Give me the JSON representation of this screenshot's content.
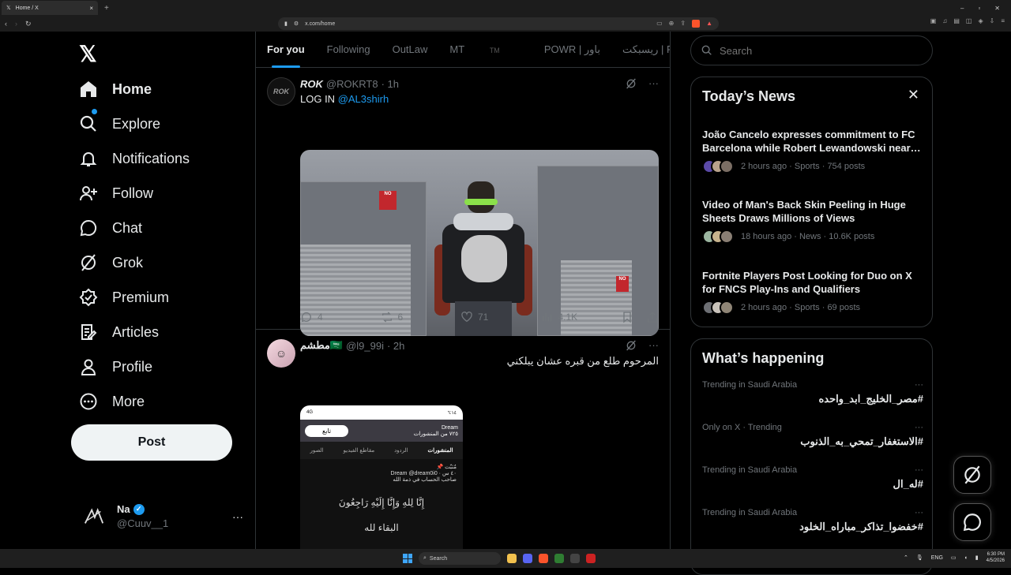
{
  "browser": {
    "tab_title": "Home / X",
    "url": "x.com/home",
    "new_tab": "+",
    "tab_close": "×",
    "win_min": "‒",
    "win_max": "▫",
    "win_close": "✕"
  },
  "sidebar": {
    "logo": "𝕏",
    "items": [
      {
        "label": "Home",
        "icon": "home-icon"
      },
      {
        "label": "Explore",
        "icon": "search-icon"
      },
      {
        "label": "Notifications",
        "icon": "bell-icon"
      },
      {
        "label": "Follow",
        "icon": "person-add-icon"
      },
      {
        "label": "Chat",
        "icon": "chat-icon"
      },
      {
        "label": "Grok",
        "icon": "grok-icon"
      },
      {
        "label": "Premium",
        "icon": "premium-icon"
      },
      {
        "label": "Articles",
        "icon": "articles-icon"
      },
      {
        "label": "Profile",
        "icon": "person-icon"
      },
      {
        "label": "More",
        "icon": "more-circle-icon"
      }
    ],
    "post_label": "Post",
    "account": {
      "name": "Na",
      "handle": "@Cuuv__1",
      "more": "···"
    }
  },
  "timeline": {
    "tabs": [
      "For you",
      "Following",
      "OutLaw",
      "MT",
      "POWR | باور",
      "ريسبكت | Respect"
    ],
    "tab_mt_suffix": "TM",
    "tweets": [
      {
        "name": "ROK",
        "handle": "@ROKRT8",
        "time": "· 1h",
        "text_prefix": "LOG IN ",
        "mention": "@AL3shirh",
        "replies": "4",
        "reposts": "6",
        "likes": "71",
        "views": "4.1K",
        "avatar_text": "ROK",
        "image_signs": [
          "NO",
          "NO"
        ]
      },
      {
        "name": "مطشم🇸🇦",
        "handle": "@l9_99i",
        "time": "· 2h",
        "text": "المرحوم طلع من قبره عشان يبلكني",
        "phone": {
          "status_time": "٦:١٤",
          "status_net": "4G",
          "follow_btn": "تابع",
          "title": "Dream",
          "subtitle": "٧٢٥ من المنشورات",
          "tabs": [
            "المنشورات",
            "الردود",
            "مقاطع الفيديو",
            "الصور"
          ],
          "pinned": "📌 مُثبّت",
          "post_author": "Dream @dream0i0 · ٤٠ س",
          "post_line": "صاحب الحساب في ذمة الله",
          "calligraphy_1": "إِنَّا لِلهِ وَإِنَّا إِلَيْهِ رَاجِعُونَ",
          "calligraphy_2": "البقاء لله"
        }
      }
    ],
    "more": "···"
  },
  "right": {
    "search_placeholder": "Search",
    "news_title": "Today’s News",
    "news": [
      {
        "headline": "João Cancelo expresses commitment to FC Barcelona while Robert Lewandowski near…",
        "meta": "2 hours ago · Sports · 754 posts"
      },
      {
        "headline": "Video of Man's Back Skin Peeling in Huge Sheets Draws Millions of Views",
        "meta": "18 hours ago · News · 10.6K posts"
      },
      {
        "headline": "Fortnite Players Post Looking for Duo on X for FNCS Play-Ins and Qualifiers",
        "meta": "2 hours ago · Sports · 69 posts"
      }
    ],
    "happening_title": "What’s happening",
    "trends": [
      {
        "context": "Trending in Saudi Arabia",
        "name": "#مصر_الخليج_ابد_واحده"
      },
      {
        "context": "Only on X · Trending",
        "name": "#الاستغفار_تمحي_به_الذنوب"
      },
      {
        "context": "Trending in Saudi Arabia",
        "name": "#له_ال"
      },
      {
        "context": "Trending in Saudi Arabia",
        "name": "#خفضوا_تذاكر_مباراه_الخلود"
      }
    ],
    "trend_more": "···"
  },
  "taskbar": {
    "search": "Search",
    "lang": "ENG",
    "time": "6:30 PM",
    "date": "4/5/2026"
  },
  "colors": {
    "accent": "#1d9bf0",
    "bg": "#000000",
    "border": "#2f3336",
    "muted": "#71767b"
  }
}
